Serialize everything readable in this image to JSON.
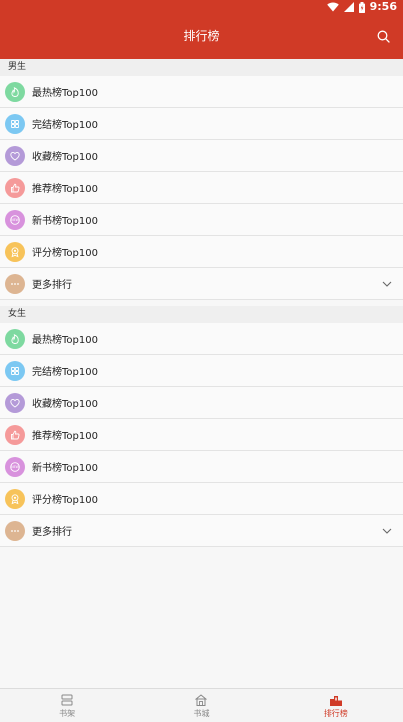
{
  "status_bar": {
    "time": "9:56"
  },
  "app_bar": {
    "title": "排行榜"
  },
  "sections": [
    {
      "header": "男生",
      "items": [
        {
          "label": "最热榜Top100",
          "icon": "flame-icon",
          "color": "#7ed9a0"
        },
        {
          "label": "完结榜Top100",
          "icon": "grid-icon",
          "color": "#7cc8f2"
        },
        {
          "label": "收藏榜Top100",
          "icon": "heart-icon",
          "color": "#b49ad8"
        },
        {
          "label": "推荐榜Top100",
          "icon": "thumbs-up-icon",
          "color": "#f59a9a"
        },
        {
          "label": "新书榜Top100",
          "icon": "new-badge-icon",
          "color": "#d892dd"
        },
        {
          "label": "评分榜Top100",
          "icon": "award-icon",
          "color": "#f7c35a"
        },
        {
          "label": "更多排行",
          "icon": "more-icon",
          "color": "#ddb592"
        }
      ]
    },
    {
      "header": "女生",
      "items": [
        {
          "label": "最热榜Top100",
          "icon": "flame-icon",
          "color": "#7ed9a0"
        },
        {
          "label": "完结榜Top100",
          "icon": "grid-icon",
          "color": "#7cc8f2"
        },
        {
          "label": "收藏榜Top100",
          "icon": "heart-icon",
          "color": "#b49ad8"
        },
        {
          "label": "推荐榜Top100",
          "icon": "thumbs-up-icon",
          "color": "#f59a9a"
        },
        {
          "label": "新书榜Top100",
          "icon": "new-badge-icon",
          "color": "#d892dd"
        },
        {
          "label": "评分榜Top100",
          "icon": "award-icon",
          "color": "#f7c35a"
        },
        {
          "label": "更多排行",
          "icon": "more-icon",
          "color": "#ddb592"
        }
      ]
    }
  ],
  "bottom_nav": [
    {
      "label": "书架",
      "icon": "bookshelf-icon"
    },
    {
      "label": "书城",
      "icon": "bookstore-icon"
    },
    {
      "label": "排行榜",
      "icon": "ranking-icon"
    }
  ],
  "colors": {
    "accent": "#d03a26"
  }
}
